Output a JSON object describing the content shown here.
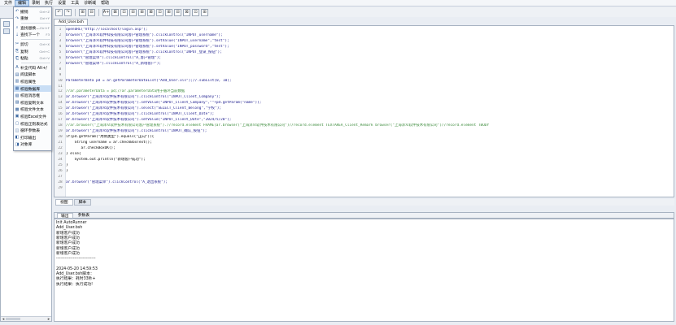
{
  "menubar": [
    "文件",
    "编辑",
    "录制",
    "执行",
    "设置",
    "工具",
    "诊断域",
    "帮助"
  ],
  "menu_active_index": 1,
  "edit_menu": [
    {
      "icon": "↶",
      "name": "undo-icon",
      "label": "撤销",
      "shortcut": "Ctrl+Z",
      "sep": false
    },
    {
      "icon": "↷",
      "name": "redo-icon",
      "label": "重做",
      "shortcut": "Ctrl+Y",
      "sep": true
    },
    {
      "icon": "⌕",
      "name": "find-icon",
      "label": "查找替换...",
      "shortcut": "Ctrl+F",
      "sep": false
    },
    {
      "icon": "⇣",
      "name": "find-next-icon",
      "label": "查找下一个",
      "shortcut": "F3",
      "sep": true
    },
    {
      "icon": "✂",
      "name": "cut-icon",
      "label": "剪切",
      "shortcut": "Ctrl+X",
      "sep": false
    },
    {
      "icon": "⎘",
      "name": "copy-icon",
      "label": "复制",
      "shortcut": "Ctrl+C",
      "sep": false
    },
    {
      "icon": "⎗",
      "name": "paste-icon",
      "label": "粘贴",
      "shortcut": "Ctrl+V",
      "sep": true
    },
    {
      "icon": "A",
      "name": "autocomplete-icon",
      "label": "补全代码 Alt+/",
      "shortcut": "",
      "sep": false
    },
    {
      "icon": "▤",
      "name": "view-script-icon",
      "label": "阅读脚本",
      "shortcut": "",
      "sep": false
    },
    {
      "icon": "▥",
      "name": "verify-property-icon",
      "label": "校验属性",
      "shortcut": "",
      "sep": false
    },
    {
      "icon": "▦",
      "name": "verify-data-icon",
      "label": "校验数据库",
      "shortcut": "",
      "sep": false,
      "highlight": true
    },
    {
      "icon": "▧",
      "name": "verify-message-icon",
      "label": "校验消息框",
      "shortcut": "",
      "sep": false
    },
    {
      "icon": "▨",
      "name": "verify-text-icon",
      "label": "校验复制文本",
      "shortcut": "",
      "sep": false
    },
    {
      "icon": "▩",
      "name": "verify-file-icon",
      "label": "校验文件文本",
      "shortcut": "",
      "sep": false
    },
    {
      "icon": "▣",
      "name": "verify-excel-icon",
      "label": "校验Excel文件",
      "shortcut": "",
      "sep": false
    },
    {
      "icon": "▢",
      "name": "verify-regex-icon",
      "label": "校验正则表达式",
      "shortcut": "",
      "sep": false
    },
    {
      "icon": "◫",
      "name": "loop-param-icon",
      "label": "循环参数表",
      "shortcut": "",
      "sep": false
    },
    {
      "icon": "◧",
      "name": "print-output-icon",
      "label": "打印输出",
      "shortcut": "",
      "sep": false
    },
    {
      "icon": "◨",
      "name": "object-lib-icon",
      "label": "对象库",
      "shortcut": "",
      "sep": false
    }
  ],
  "toolbar": [
    "↶",
    "↷",
    "⊞",
    "⊟",
    "A+",
    "⊠",
    "⊡",
    "⊟",
    "⊞",
    "⊠",
    "⊡",
    "⊞",
    "⊟",
    "⊠",
    "⊡",
    "⊞"
  ],
  "file_tab": "Add_User.bsh",
  "code": [
    {
      "n": "1",
      "t": "openURL(\"http://localhost/login.asp\");",
      "k": "code"
    },
    {
      "n": "2",
      "t": "browser(\"上海泽众软件科技有限公司客户管理系统\").clickControl(\"INPUT_username\");",
      "k": "code"
    },
    {
      "n": "3",
      "t": "browser(\"上海泽众软件科技有限公司客户管理系统\").setValue(\"INPUT_username\",\"test\");",
      "k": "code"
    },
    {
      "n": "4",
      "t": "browser(\"上海泽众软件科技有限公司客户管理系统\").setValue(\"INPUT_password\",\"test\");",
      "k": "code"
    },
    {
      "n": "5",
      "t": "browser(\"上海泽众软件科技有限公司客户管理系统\").clickControl(\"INPUT_登录_按钮\");",
      "k": "code"
    },
    {
      "n": "6",
      "t": "browser(\"管理菜单\").clickControl(\"A_客户管理\");",
      "k": "code"
    },
    {
      "n": "7",
      "t": "browser(\"管理菜单\").clickControl(\"A_新增客户\");",
      "k": "code"
    },
    {
      "n": "8",
      "t": "",
      "k": "plain"
    },
    {
      "n": "9",
      "t": "",
      "k": "plain"
    },
    {
      "n": "10",
      "t": "ParameterData pd = ar.getParameterDataList(\"Add_User.xls\");//.subList(0, 10);",
      "k": "code"
    },
    {
      "n": "11",
      "t": "",
      "k": "plain"
    },
    {
      "n": "12",
      "t": "//ar.parameterData = pd;//ar.parameterData用于循环当前数据",
      "k": "comment"
    },
    {
      "n": "13",
      "t": "ar.browser(\"上海泽众软件技术有限公司\").clickControl(\"INPUT_Client_Company\");",
      "k": "code"
    },
    {
      "n": "14",
      "t": "ar.browser(\"上海泽众软件技术有限公司\").setValue(\"INPUT_Client_Company\",\"\"+pd.getParam(\"name\"));",
      "k": "code"
    },
    {
      "n": "15",
      "t": "ar.browser(\"上海泽众软件技术有限公司\").select(\"SELECT_Client_Belong\",\"学校\");",
      "k": "code"
    },
    {
      "n": "16",
      "t": "ar.browser(\"上海泽众软件技术有限公司\").clickControl(\"INPUT_Client_Date\");",
      "k": "code"
    },
    {
      "n": "17",
      "t": "ar.browser(\"上海泽众软件技术有限公司\").setValue(\"INPUT_Client_Date\",\"2024/5/20\");",
      "k": "code"
    },
    {
      "n": "18",
      "t": "//ar.browser(\"上海泽众软件技术有限公司客户管理系统\").//record.element FRAME(ar.browser(\"上海泽众软件技术有限公司\")//record.element TEXTAREA_Client_Remark browser(\"上海泽众软件技术有限公司\")//record.element TBODY",
      "k": "comment"
    },
    {
      "n": "19",
      "t": "ar.browser(\"上海泽众软件技术有限公司\").clickControl(\"INPUT_确认_按钮\");",
      "k": "code"
    },
    {
      "n": "20",
      "t": "if(pd.getParam(\"用例类型\").equals(\"正向\")){",
      "k": "plain"
    },
    {
      "n": "21",
      "t": "    String username = ar.checkBoxText();",
      "k": "plain"
    },
    {
      "n": "22",
      "t": "       ar.checkBoxOK();",
      "k": "plain"
    },
    {
      "n": "23",
      "t": "} else{",
      "k": "plain"
    },
    {
      "n": "24",
      "t": "    System.out.println(\"新增客户成功\");",
      "k": "plain"
    },
    {
      "n": "25",
      "t": "}",
      "k": "plain"
    },
    {
      "n": "26",
      "t": "}",
      "k": "plain"
    },
    {
      "n": "27",
      "t": "",
      "k": "plain"
    },
    {
      "n": "28",
      "t": "ar.browser(\"管理菜单\").clickControl(\"A_退出系统\");",
      "k": "code"
    },
    {
      "n": "29",
      "t": "",
      "k": "plain"
    }
  ],
  "view_tabs": [
    "视图",
    "脚本"
  ],
  "view_tab_active": 0,
  "output_tabs": [
    "输出",
    "参数表"
  ],
  "output_tab_active": 0,
  "output": [
    "Init AutoRunner",
    "Add_User.bsh",
    "新增客户成功",
    "新增客户成功",
    "新增客户成功",
    "新增客户成功",
    "新增客户成功",
    "----------------------------",
    "",
    "2024-05-20 14:59:53",
    "Add_User.bsh脚本：",
    "执行结果：耗时33秒+",
    "执行结果：执行成功!"
  ]
}
